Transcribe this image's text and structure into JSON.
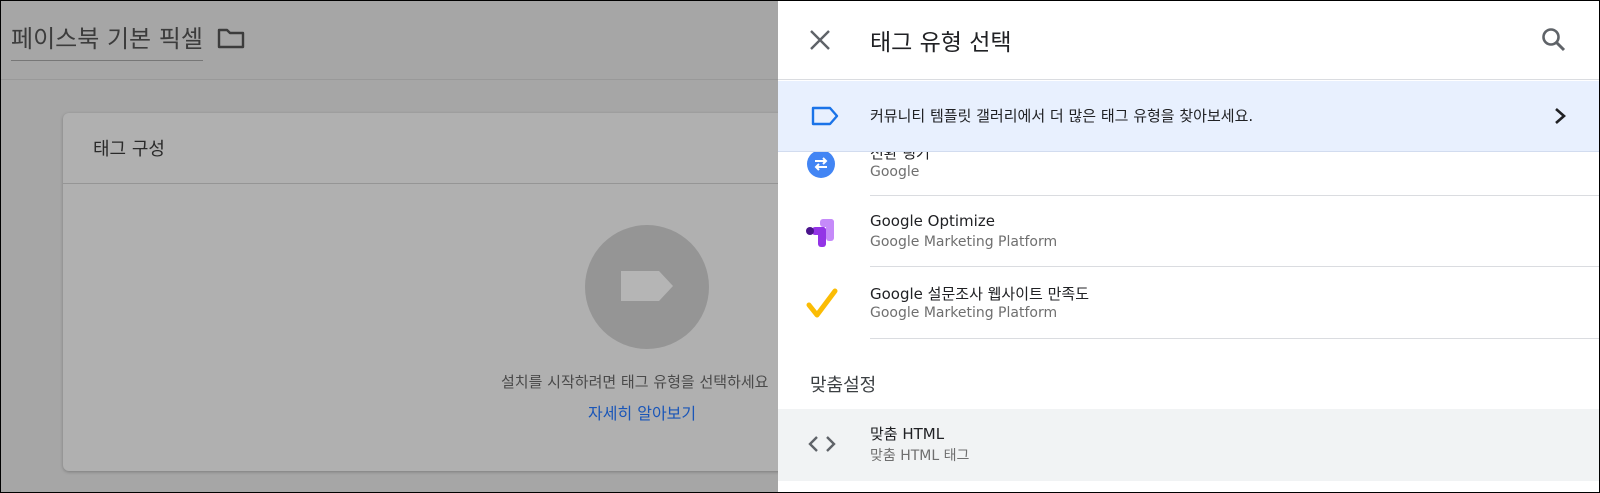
{
  "background": {
    "tag_name": "페이스북 기본 픽셀",
    "card_title": "태그 구성",
    "hint_text": "설치를 시작하려면 태그 유형을 선택하세요",
    "learn_more": "자세히 알아보기"
  },
  "panel": {
    "title": "태그 유형 선택",
    "banner_text": "커뮤니티 템플릿 갤러리에서 더 많은 태그 유형을 찾아보세요.",
    "items": [
      {
        "name": "전환 링커",
        "provider": "Google",
        "icon": "conversion-linker-icon"
      },
      {
        "name": "Google Optimize",
        "provider": "Google Marketing Platform",
        "icon": "google-optimize-icon"
      },
      {
        "name": "Google 설문조사 웹사이트 만족도",
        "provider": "Google Marketing Platform",
        "icon": "survey-check-icon"
      }
    ],
    "section_label": "맞춤설정",
    "custom_item": {
      "name": "맞춤 HTML",
      "provider": "맞춤 HTML 태그",
      "icon": "code-icon"
    }
  },
  "colors": {
    "accent_blue": "#1a73e8",
    "banner_bg": "#e8f0fe",
    "overlay_grey": "#a6a6a6",
    "optimize_purple": "#9334e6",
    "survey_yellow": "#fbbc04"
  }
}
